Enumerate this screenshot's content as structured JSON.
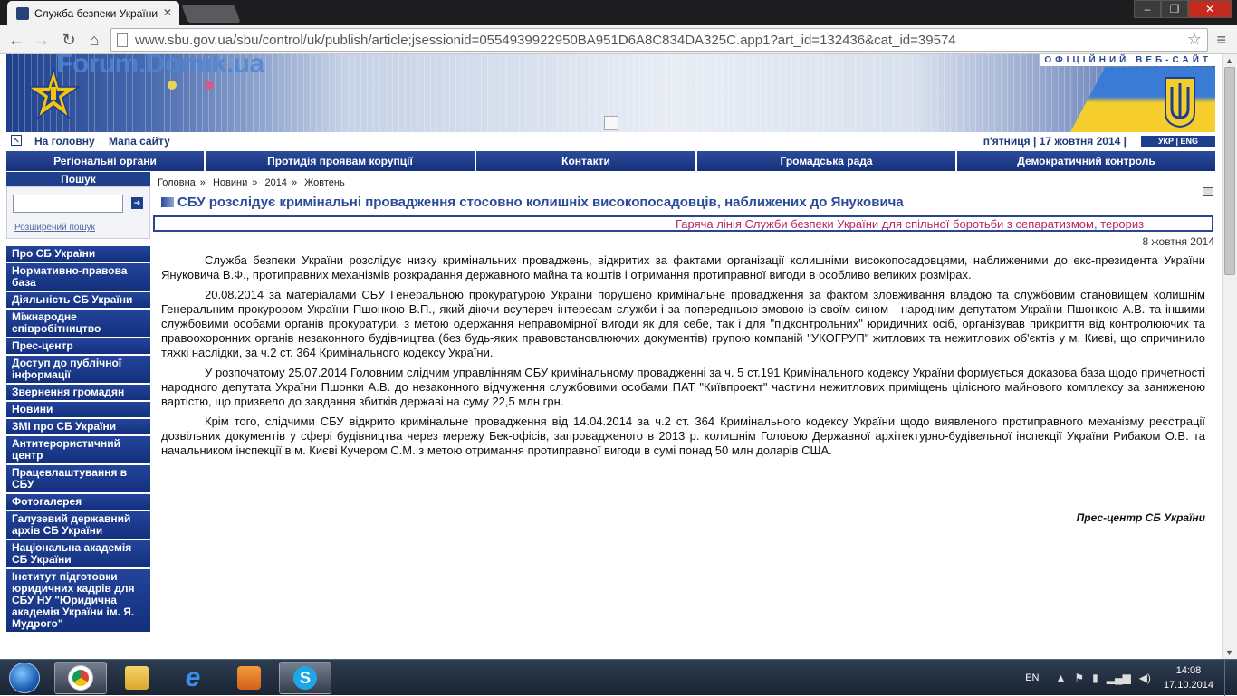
{
  "browser": {
    "tab_title": "Служба безпеки України",
    "url": "www.sbu.gov.ua/sbu/control/uk/publish/article;jsessionid=0554939922950BA951D6A8C834DA325C.app1?art_id=132436&cat_id=39574",
    "window_buttons": {
      "minimize": "–",
      "maximize": "❐",
      "close": "✕"
    }
  },
  "header": {
    "watermark": "Forum.Domik.ua",
    "official": "ОФІЦІЙНИЙ ВЕБ-САЙТ"
  },
  "toplinks": {
    "home": "На головну",
    "sitemap": "Мапа сайту",
    "date": "п'ятниця | 17 жовтня 2014 |",
    "lang": "УКР | ENG"
  },
  "mainnav": [
    "Регіональні органи",
    "Протидія проявам корупції",
    "Контакти",
    "Громадська рада",
    "Демократичний контроль"
  ],
  "search": {
    "title": "Пошук",
    "value": "",
    "advanced": "Розширений пошук"
  },
  "sidemenu": [
    "Про СБ України",
    "Нормативно-правова база",
    "Діяльність СБ України",
    "Міжнародне співробітництво",
    "Прес-центр",
    "Доступ до публічної інформації",
    "Звернення громадян",
    "Новини",
    "ЗМІ про СБ України",
    "Антитерористичний центр",
    "Працевлаштування в СБУ",
    "Фотогалерея",
    "Галузевий державний архів СБ України",
    "Національна академія СБ України",
    "Інститут підготовки юридичних кадрів для СБУ НУ \"Юридична академія України ім. Я. Мудрого\""
  ],
  "breadcrumb": [
    "Головна",
    "Новини",
    "2014",
    "Жовтень"
  ],
  "breadcrumb_sep": "»",
  "article": {
    "title": "СБУ розслідує кримінальні провадження стосовно колишніх високопосадовців, наближених до Януковича",
    "ticker": "Гаряча лінія Служби безпеки України для спільної боротьби з сепаратизмом, терориз",
    "date": "8 жовтня 2014",
    "paragraphs": [
      "Служба безпеки України розслідує низку кримінальних проваджень, відкритих за фактами організації колишніми високопосадовцями, наближеними до екс-президента України Януковича В.Ф., протиправних механізмів розкрадання державного майна та коштів і отримання протиправної вигоди в особливо великих розмірах.",
      "20.08.2014 за матеріалами СБУ Генеральною прокуратурою України порушено кримінальне провадження за фактом зловживання владою та службовим становищем колишнім Генеральним прокурором України Пшонкою В.П., який діючи всупереч інтересам служби і за попередньою змовою із своїм сином - народним депутатом України Пшонкою А.В. та іншими службовими особами органів прокуратури, з метою одержання неправомірної вигоди як для себе, так і для \"підконтрольних\" юридичних осіб, організував прикриття від контролюючих та правоохоронних органів незаконного будівництва (без будь-яких правовстановлюючих документів) групою компаній \"УКОГРУП\" житлових та нежитлових об'єктів у м. Києві, що спричинило тяжкі наслідки, за ч.2 ст. 364 Кримінального кодексу України.",
      "У розпочатому 25.07.2014 Головним слідчим управлінням СБУ кримінальному провадженні за ч. 5 ст.191 Кримінального кодексу України формується доказова база щодо причетності народного депутата України Пшонки А.В. до незаконного відчуження службовими особами ПАТ \"Київпроект\" частини нежитлових приміщень цілісного майнового комплексу за заниженою вартістю, що призвело до завдання збитків державі на суму 22,5 млн грн.",
      "Крім того, слідчими СБУ відкрито кримінальне провадження від 14.04.2014 за ч.2 ст. 364 Кримінального кодексу України щодо виявленого протиправного механізму реєстрації дозвільних документів у сфері будівництва через мережу Бек-офісів, запровадженого в 2013 р. колишнім Головою Державної архітектурно-будівельної інспекції України Рибаком О.В. та начальником інспекції в м. Києві Кучером С.М. з метою отримання протиправної вигоди в сумі понад 50 млн доларів США."
    ],
    "signature": "Прес-центр СБ України"
  },
  "taskbar": {
    "lang": "EN",
    "time": "14:08",
    "date": "17.10.2014"
  },
  "colors": {
    "brand_blue": "#1e3f8c",
    "ticker_text": "#b3266d",
    "title_blue": "#2b4a9a"
  }
}
